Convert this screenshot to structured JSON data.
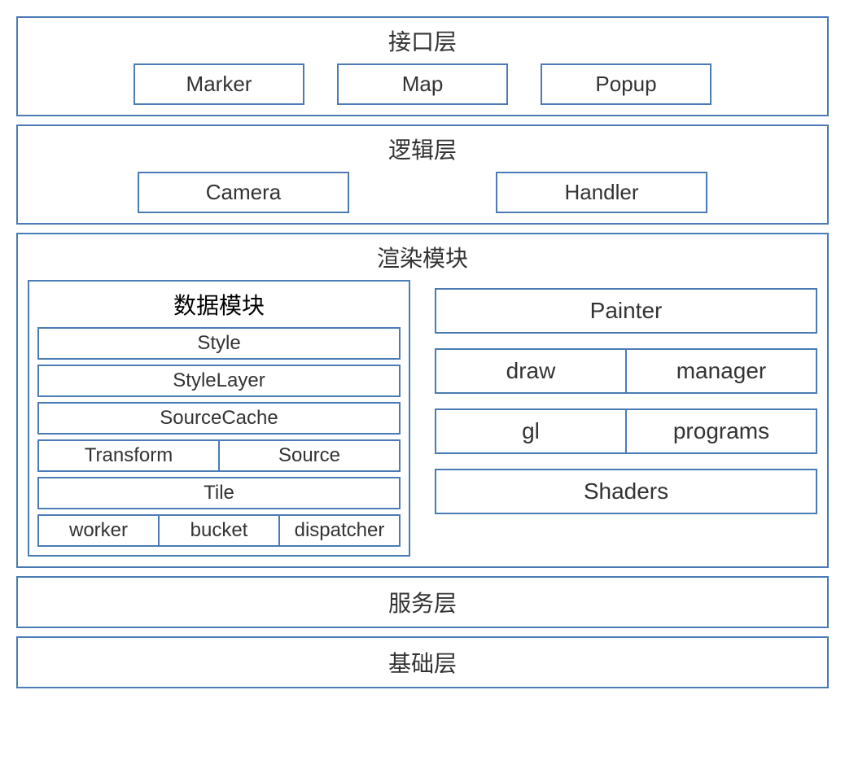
{
  "interface": {
    "title": "接口层",
    "items": [
      "Marker",
      "Map",
      "Popup"
    ]
  },
  "logic": {
    "title": "逻辑层",
    "items": [
      "Camera",
      "Handler"
    ]
  },
  "render": {
    "title": "渲染模块",
    "data_module": {
      "title": "数据模块",
      "rows": [
        [
          "Style"
        ],
        [
          "StyleLayer"
        ],
        [
          "SourceCache"
        ],
        [
          "Transform",
          "Source"
        ],
        [
          "Tile"
        ],
        [
          "worker",
          "bucket",
          "dispatcher"
        ]
      ]
    },
    "right": {
      "rows": [
        [
          "Painter"
        ],
        [
          "draw",
          "manager"
        ],
        [
          "gl",
          "programs"
        ],
        [
          "Shaders"
        ]
      ]
    }
  },
  "service": {
    "title": "服务层"
  },
  "base": {
    "title": "基础层"
  }
}
